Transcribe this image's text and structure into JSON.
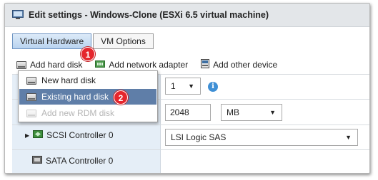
{
  "window": {
    "title": "Edit settings - Windows-Clone (ESXi 6.5 virtual machine)"
  },
  "tabs": [
    {
      "label": "Virtual Hardware",
      "active": true
    },
    {
      "label": "VM Options",
      "active": false
    }
  ],
  "toolbar": {
    "add_hard_disk": "Add hard disk",
    "add_network_adapter": "Add network adapter",
    "add_other_device": "Add other device"
  },
  "dropdown": {
    "items": [
      {
        "label": "New hard disk",
        "state": "normal"
      },
      {
        "label": "Existing hard disk",
        "state": "selected"
      },
      {
        "label": "Add new RDM disk",
        "state": "disabled"
      }
    ]
  },
  "markers": {
    "first": "1",
    "second": "2"
  },
  "fields": {
    "cpu_select": "1",
    "memory_value": "2048",
    "memory_unit": "MB",
    "scsi_type": "LSI Logic SAS"
  },
  "tree": {
    "scsi_controller": "SCSI Controller 0",
    "sata_controller": "SATA Controller 0"
  },
  "colors": {
    "accent": "#5f7ea8",
    "marker": "#e5262d",
    "info": "#3f8fd5"
  }
}
